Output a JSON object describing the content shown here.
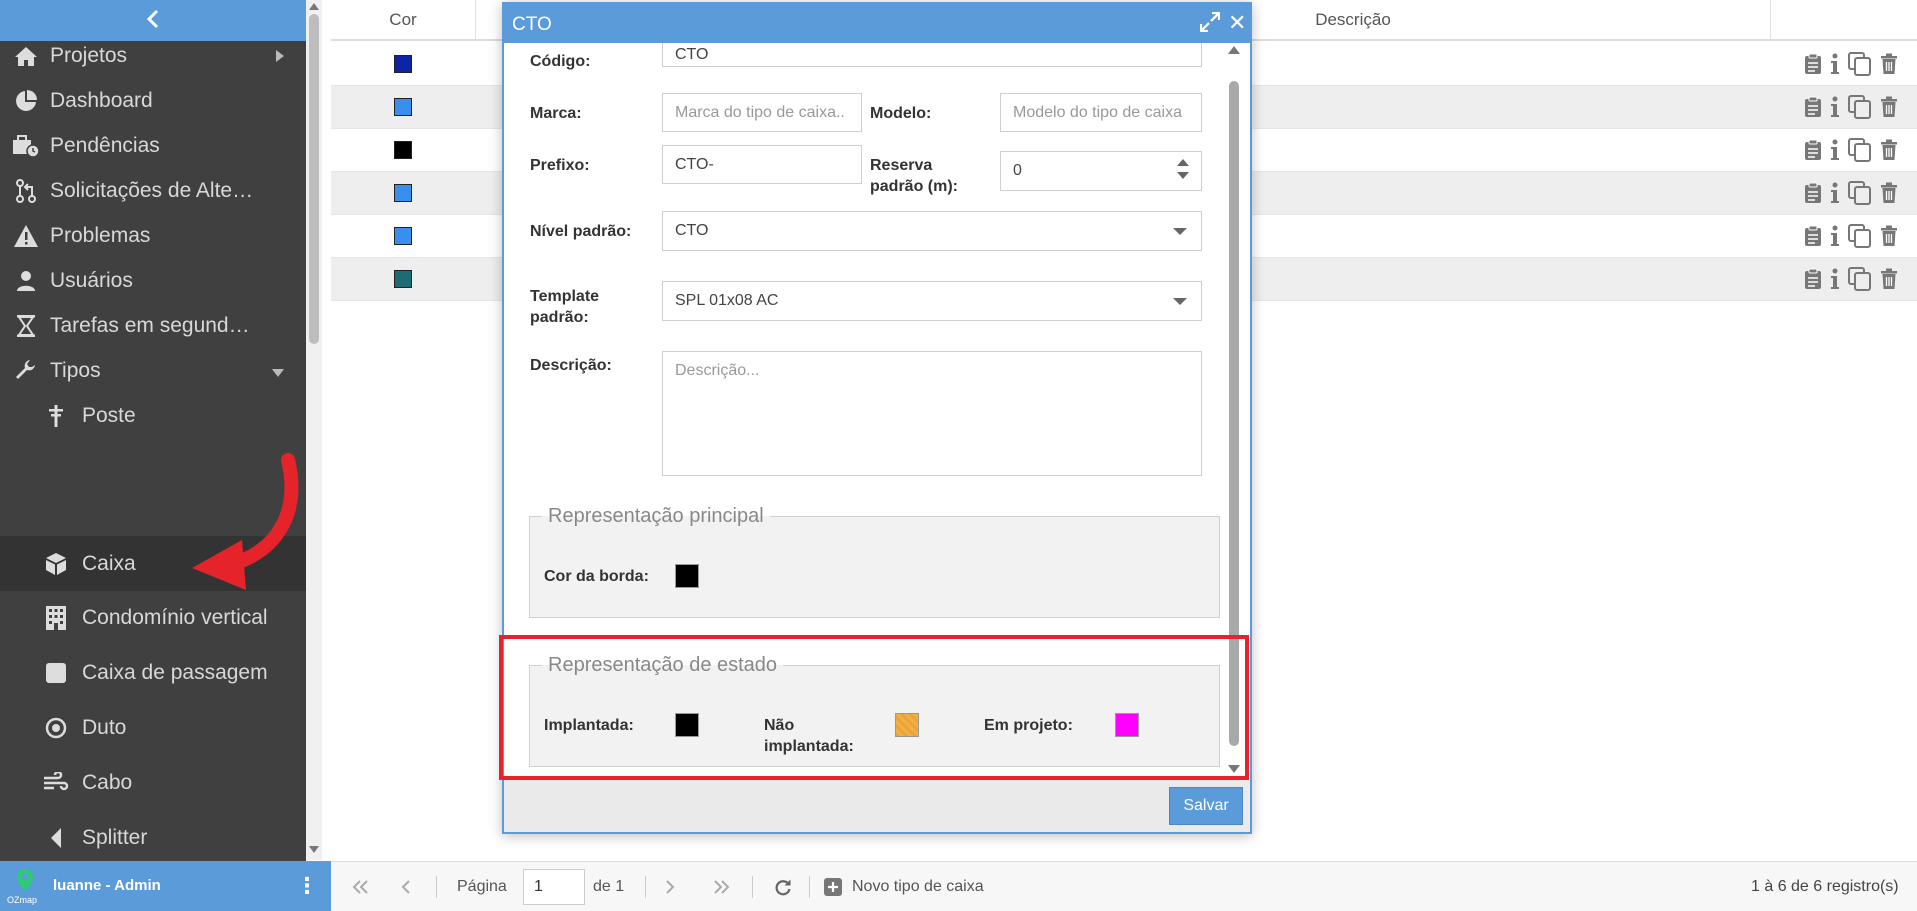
{
  "sidebar": {
    "collapse_icon": "chevron-left-icon",
    "items": [
      {
        "label": "Projetos",
        "icon": "home-icon",
        "arrow": "right"
      },
      {
        "label": "Dashboard",
        "icon": "pie-chart-icon"
      },
      {
        "label": "Pendências",
        "icon": "briefcase-clock-icon"
      },
      {
        "label": "Solicitações de Altera...",
        "icon": "git-pull-request-icon"
      },
      {
        "label": "Problemas",
        "icon": "warning-icon"
      },
      {
        "label": "Usuários",
        "icon": "user-icon"
      },
      {
        "label": "Tarefas em segundo ...",
        "icon": "hourglass-icon"
      },
      {
        "label": "Tipos",
        "icon": "wrench-icon",
        "arrow": "down"
      },
      {
        "label": "Poste",
        "icon": "pole-icon"
      },
      {
        "label": "Caixa",
        "icon": "box-icon",
        "active": true
      },
      {
        "label": "Condomínio vertical",
        "icon": "building-icon"
      },
      {
        "label": "Caixa de passagem",
        "icon": "square-icon"
      },
      {
        "label": "Duto",
        "icon": "target-icon"
      },
      {
        "label": "Cabo",
        "icon": "cable-icon"
      },
      {
        "label": "Splitter",
        "icon": "splitter-icon"
      }
    ],
    "footer": {
      "user": "luanne - Admin",
      "logo_text": "OZmap"
    }
  },
  "table": {
    "columns": {
      "cor": "Cor",
      "descricao": "Descrição"
    },
    "rows": [
      {
        "color": "#0b24a8"
      },
      {
        "color": "#3a8ef0"
      },
      {
        "color": "#000000"
      },
      {
        "color": "#3a8ef0"
      },
      {
        "color": "#3a8ef0"
      },
      {
        "color": "#1d6b73"
      }
    ]
  },
  "toolbar": {
    "page_label": "Página",
    "page_value": "1",
    "of_label": "de 1",
    "new_label": "Novo tipo de caixa",
    "records": "1 à 6 de 6 registro(s)"
  },
  "modal": {
    "title": "CTO",
    "codigo": {
      "label": "Código:",
      "value": "CTO"
    },
    "marca": {
      "label": "Marca:",
      "placeholder": "Marca do tipo de caixa.."
    },
    "modelo": {
      "label": "Modelo:",
      "placeholder": "Modelo do tipo de caixa"
    },
    "prefixo": {
      "label": "Prefixo:",
      "value": "CTO-"
    },
    "reserva": {
      "label_line1": "Reserva",
      "label_line2": "padrão (m):",
      "value": "0"
    },
    "nivel": {
      "label": "Nível padrão:",
      "value": "CTO"
    },
    "template": {
      "label_line1": "Template",
      "label_line2": "padrão:",
      "value": "SPL 01x08 AC"
    },
    "descricao": {
      "label": "Descrição:",
      "placeholder": "Descrição..."
    },
    "rep_principal": {
      "legend": "Representação principal",
      "cor_borda_label": "Cor da borda:",
      "cor_borda": "#000000"
    },
    "rep_estado": {
      "legend": "Representação de estado",
      "implantada_label": "Implantada:",
      "implantada_color": "#000000",
      "nao_implantada_line1": "Não",
      "nao_implantada_line2": "implantada:",
      "nao_implantada_color": "#f5b041",
      "em_projeto_label": "Em projeto:",
      "em_projeto_color": "#ff00ff"
    },
    "save_label": "Salvar"
  },
  "colors": {
    "accent": "#5b9bd9",
    "sidebar_bg": "#404040",
    "highlight": "#e5232b"
  }
}
